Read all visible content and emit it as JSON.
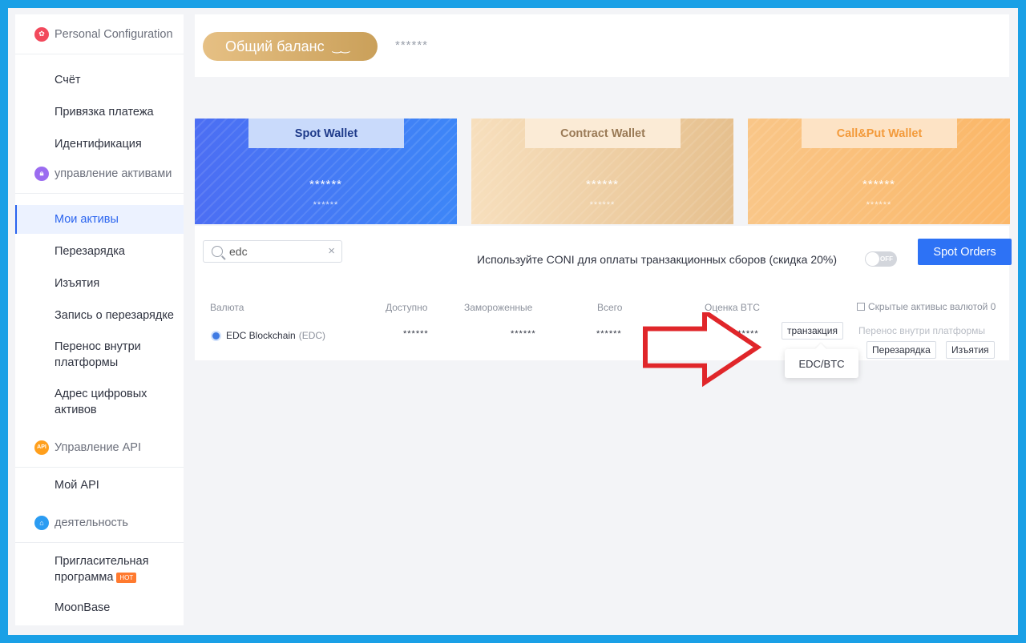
{
  "sidebar": {
    "sections": [
      {
        "title": "Personal Configuration",
        "icon": "user-config-icon",
        "color": "#f2495c"
      },
      {
        "title": "управление активами",
        "icon": "assets-lock-icon",
        "color": "#9b6cf0"
      },
      {
        "title": "Управление API",
        "icon": "api-icon",
        "color": "#ff9f1c",
        "badge": "API"
      },
      {
        "title": "деятельность",
        "icon": "activity-icon",
        "color": "#2b9cf2"
      }
    ],
    "items": {
      "account": "Счёт",
      "payment_binding": "Привязка платежа",
      "identification": "Идентификация",
      "my_assets": "Мои активы",
      "recharge": "Перезарядка",
      "withdrawals": "Изъятия",
      "recharge_record": "Запись о перезарядке",
      "internal_transfer": "Перенос внутри платформы",
      "digital_address": "Адрес цифровых активов",
      "my_api": "Мой API",
      "referral": "Пригласительная программа",
      "referral_badge": "HOT",
      "moonbase": "MoonBase"
    }
  },
  "balance": {
    "label": "Общий баланс",
    "value": "******"
  },
  "wallets": [
    {
      "name": "Spot Wallet",
      "amount": "******",
      "sub": "******"
    },
    {
      "name": "Contract Wallet",
      "amount": "******",
      "sub": "******"
    },
    {
      "name": "Call&Put Wallet",
      "amount": "******",
      "sub": "******"
    }
  ],
  "assets": {
    "search_value": "edc",
    "coni_text": "Используйте CONI для оплаты транзакционных сборов (скидка 20%)",
    "toggle_label": "OFF",
    "spot_orders": "Spot Orders",
    "columns": {
      "currency": "Валюта",
      "available": "Доступно",
      "frozen": "Замороженные",
      "total": "Всего",
      "btc_estimate": "Оценка BTC"
    },
    "hidden_assets": "Скрытые активыс валютой 0",
    "row": {
      "coin_name": "EDC Blockchain",
      "coin_ticker": "(EDC)",
      "available": "******",
      "frozen": "******",
      "total": "******",
      "btc": "******",
      "btn_trade": "транзакция",
      "btn_transfer": "Перенос внутри платформы",
      "btn_recharge": "Перезарядка",
      "btn_withdraw": "Изъятия"
    },
    "tooltip_pair": "EDC/BTC"
  },
  "colors": {
    "frame": "#1aa0e6",
    "accent": "#2d72f5",
    "arrow": "#e0262a"
  }
}
